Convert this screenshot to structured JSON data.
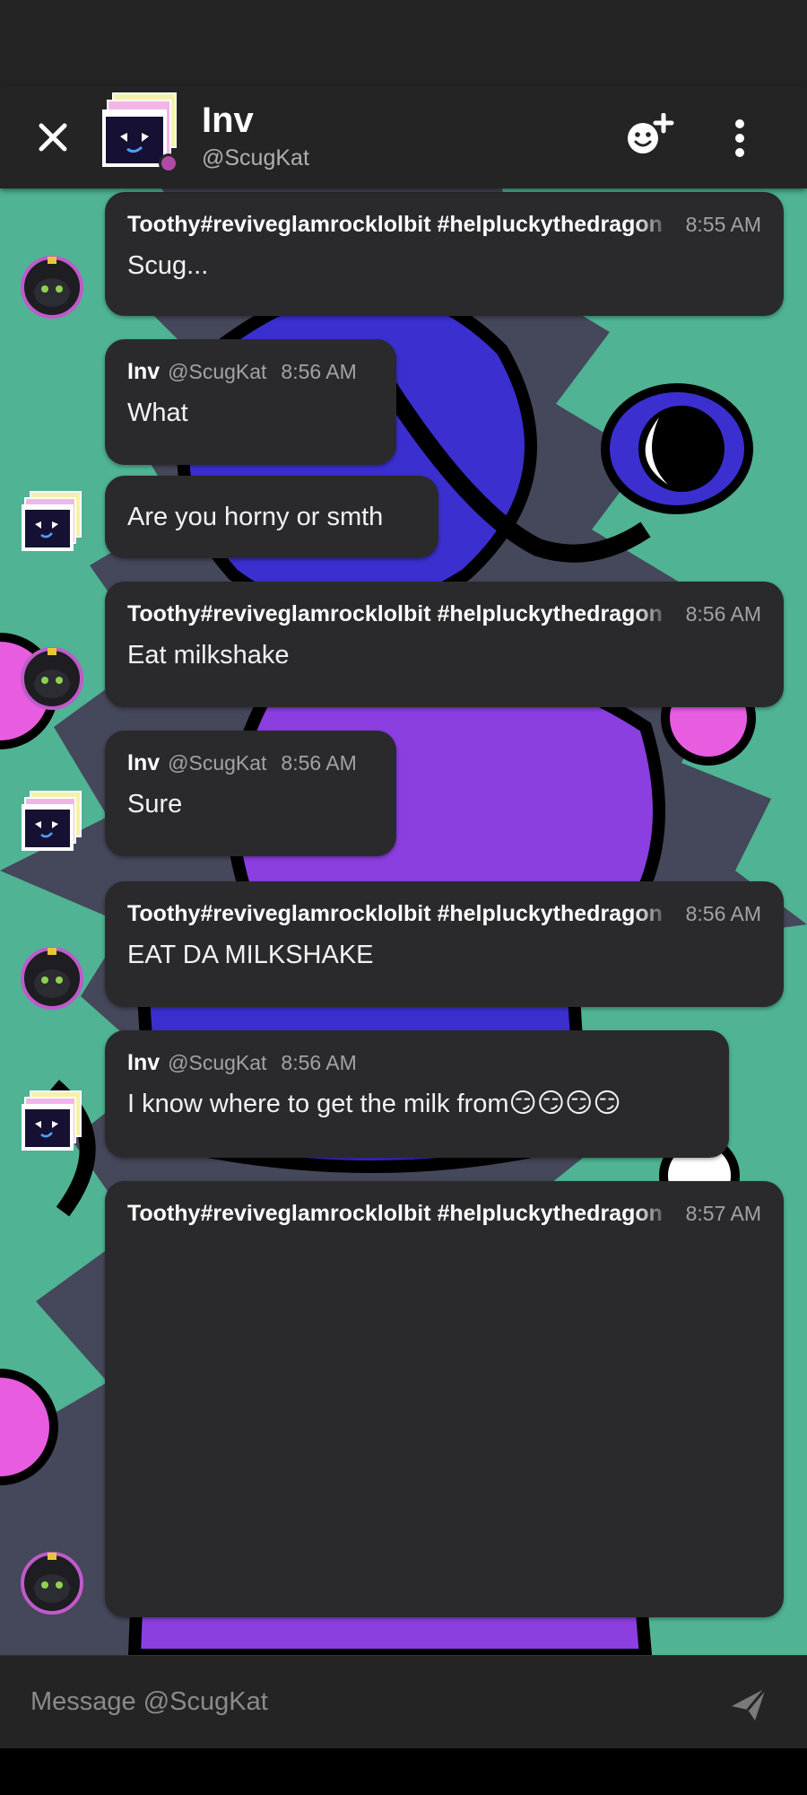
{
  "header": {
    "name": "Inv",
    "handle": "@ScugKat"
  },
  "messages": [
    {
      "author": "Toothy#reviveglamrocklolbit #helpluckythedragon",
      "time": "8:55 AM",
      "text": "Scug...",
      "side": "toothy"
    },
    {
      "author": "Inv",
      "handle": "@ScugKat",
      "time": "8:56 AM",
      "text": "What",
      "side": "inv"
    },
    {
      "text": "Are you horny or smth",
      "side": "inv",
      "continuation": true
    },
    {
      "author": "Toothy#reviveglamrocklolbit #helpluckythedragon",
      "time": "8:56 AM",
      "text": "Eat milkshake",
      "side": "toothy"
    },
    {
      "author": "Inv",
      "handle": "@ScugKat",
      "time": "8:56 AM",
      "text": "Sure",
      "side": "inv"
    },
    {
      "author": "Toothy#reviveglamrocklolbit #helpluckythedragon",
      "time": "8:56 AM",
      "text": "EAT DA MILKSHAKE",
      "side": "toothy"
    },
    {
      "author": "Inv",
      "handle": "@ScugKat",
      "time": "8:56 AM",
      "text": "I know where to get the milk from",
      "emoji": "😏😏😏😏",
      "side": "inv"
    },
    {
      "author": "Toothy#reviveglamrocklolbit #helpluckythedragon",
      "time": "8:57 AM",
      "text": "",
      "side": "toothy"
    }
  ],
  "composer": {
    "placeholder": "Message @ScugKat"
  },
  "icons": {
    "close": "close-icon",
    "add_user": "add-user-icon",
    "more": "more-vertical-icon",
    "send": "send-icon"
  },
  "colors": {
    "bubble": "#2a2a2c",
    "header": "#242424",
    "status_dot": "#b04aa8",
    "wallpaper_teal": "#4fb394",
    "wallpaper_purple": "#8b3fe0",
    "wallpaper_blue": "#3b2fd0"
  }
}
